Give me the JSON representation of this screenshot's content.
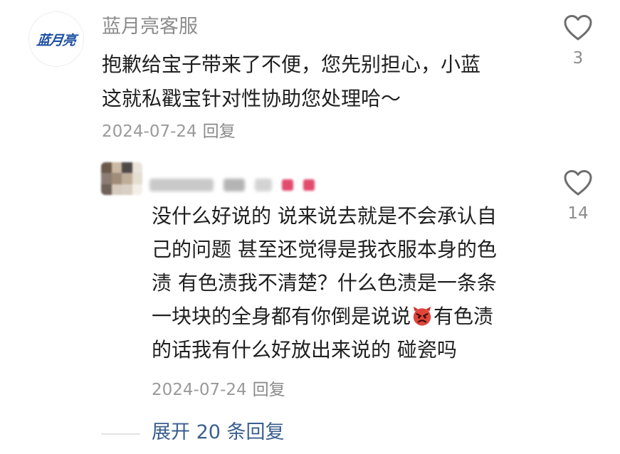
{
  "comment": {
    "brand_logo_text": "蓝月亮",
    "author": "蓝月亮客服",
    "text_line1": "抱歉给宝子带来了不便，您先别担心，小蓝",
    "text_line2": "这就私戳宝针对性协助您处理哈～",
    "date": "2024-07-24",
    "reply_label": "回复",
    "likes": "3"
  },
  "reply": {
    "name_blurred": true,
    "text_line1": "没什么好说的 说来说去就是不会承认自",
    "text_line2": "己的问题 甚至还觉得是我衣服本身的色",
    "text_line3": "渍 有色渍我不清楚？什么色渍是一条条",
    "text_line4_before_emoji": "一块块的全身都有你倒是说说",
    "emoji": "angry-devil-emoji",
    "text_line4_after_emoji": "有色渍",
    "text_line5": "的话我有什么好放出来说的 碰瓷吗",
    "date": "2024-07-24",
    "reply_label": "回复",
    "likes": "14"
  },
  "expand": {
    "label": "展开 20 条回复"
  },
  "colors": {
    "brand_blue": "#1b4fa3",
    "link_blue": "#3a5f8f",
    "text": "#1f1f1f",
    "muted": "#9a9a9a"
  }
}
